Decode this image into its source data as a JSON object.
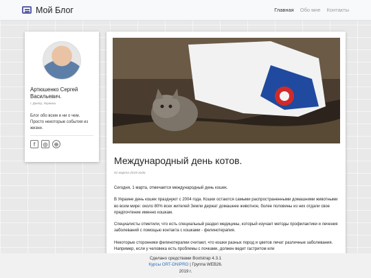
{
  "navbar": {
    "brand": "Мой Блог",
    "links": [
      {
        "label": "Главная",
        "active": true
      },
      {
        "label": "Обо мне",
        "active": false
      },
      {
        "label": "Контакты",
        "active": false
      }
    ]
  },
  "sidebar": {
    "name": "Артюшенко Сергей Васильевич.",
    "location": "г. Днепр, Украина",
    "bio": "Блог обо всем и ни о чем. Просто некоторые события из жизни.",
    "socials": [
      "facebook-icon",
      "instagram-icon",
      "globe-icon"
    ]
  },
  "post": {
    "title": "Международный день котов.",
    "date": "01 марта 2019 года",
    "paragraphs": [
      "Сегодня, 1 марта, отмечается международный день кошек.",
      "В Украине день кошек празднуют с 2004 года. Кошки остаются самыми распространенными домашними животными во всем мире: около 80% всех жителей Земли держат домашнее животное, более половины из них отдали свое предпочтение именно кошкам.",
      "Специалисты отметили, что есть специальный раздел медицины, который изучает методы профилактики и лечения заболеваний с помощью контакта с кошками - фелинотерапия.",
      "Некоторые сторонники фелинотерапии считают, что кошки разных пород и цветов лечат различные заболевания. Например, если у человека есть проблемы с почками, должен ведет гастритом или"
    ]
  },
  "footer": {
    "line1": "Сделано средствами Bootstrap 4.3.1",
    "link": "Курсы ORT-DNIPRO",
    "line2_rest": " | Группа WEB26.",
    "line3": "2019 г."
  },
  "colors": {
    "accent": "#5a5fa8",
    "link": "#2a6ebb"
  }
}
